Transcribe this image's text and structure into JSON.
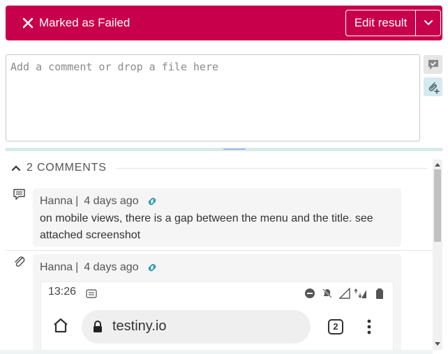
{
  "status": {
    "label": "Marked as Failed",
    "color": "#c8004b",
    "icon": "close-icon"
  },
  "actions": {
    "edit_result": "Edit result",
    "dropdown_icon": "chevron-down-icon"
  },
  "composer": {
    "placeholder": "Add a comment or drop a file here",
    "side_icons": [
      "comment-icon",
      "attach-icon"
    ]
  },
  "comments_section": {
    "title": "2 COMMENTS",
    "collapse_icon": "chevron-up-icon",
    "comments": [
      {
        "type_icon": "comment-icon",
        "author": "Hanna",
        "separator": "|",
        "time": "4 days ago",
        "link_icon": "link-icon",
        "text": "on mobile views, there is a gap between the menu and the title. see attached screenshot"
      },
      {
        "type_icon": "attachment-icon",
        "author": "Hanna",
        "separator": "|",
        "time": "4 days ago",
        "link_icon": "link-icon",
        "attachment": {
          "time": "13:26",
          "url": "testiny.io",
          "tab_count": "2"
        }
      }
    ]
  }
}
